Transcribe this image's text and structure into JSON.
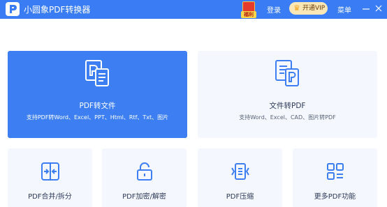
{
  "titlebar": {
    "app_title": "小圆象PDF转换器",
    "gift_label": "福利",
    "login": "登录",
    "vip_label": "开通VIP",
    "menu": "菜单"
  },
  "cards": [
    {
      "title": "PDF转文件",
      "desc": "支持PDF转Word、Excel、PPT、Html、Rtf、Txt、图片"
    },
    {
      "title": "文件转PDF",
      "desc": "支持Word、Excel、CAD、图片转PDF"
    }
  ],
  "tools": [
    {
      "title": "PDF合并/拆分"
    },
    {
      "title": "PDF加密/解密"
    },
    {
      "title": "PDF压缩"
    },
    {
      "title": "更多PDF功能"
    }
  ],
  "colors": {
    "primary": "#3a7cf4",
    "card_selected": "#3d7ff2",
    "card_bg": "#f4f7fd",
    "icon_blue": "#3d7ff2",
    "vip_bg": "#fbe7b6"
  },
  "icons": {
    "logo": "app-logo-icon",
    "gift": "gift-icon",
    "vip": "crown-icon",
    "minimize": "minimize-icon",
    "close": "close-icon",
    "pdf_to_file": "pdf-to-file-icon",
    "file_to_pdf": "file-to-pdf-icon",
    "merge_split": "merge-split-icon",
    "encrypt": "unlock-icon",
    "compress": "compress-icon",
    "more": "grid-icon"
  }
}
